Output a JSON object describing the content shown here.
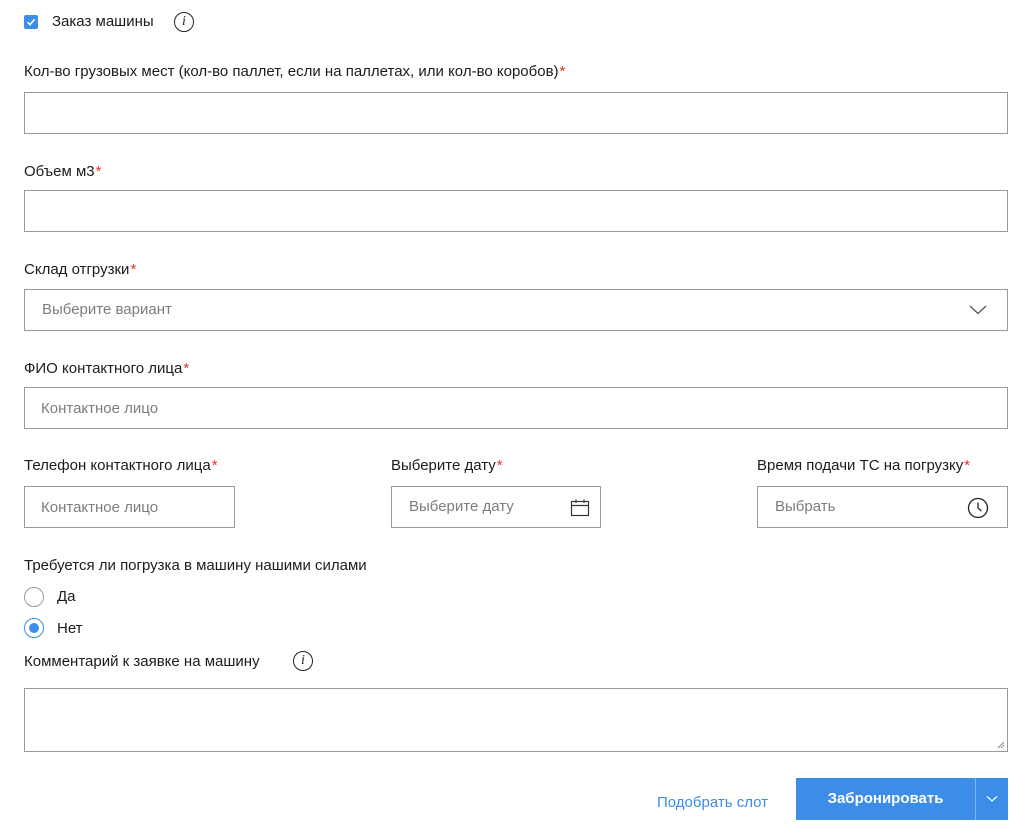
{
  "order_car": {
    "label": "Заказ машины",
    "checked": true
  },
  "cargo_places": {
    "label": "Кол-во грузовых мест (кол-во паллет, если на паллетах, или кол-во коробов)",
    "required_mark": "*",
    "value": ""
  },
  "volume": {
    "label": "Объем м3",
    "required_mark": "*",
    "value": ""
  },
  "warehouse": {
    "label": "Склад отгрузки",
    "required_mark": "*",
    "placeholder": "Выберите вариант"
  },
  "contact_name": {
    "label": "ФИО контактного лица",
    "required_mark": "*",
    "placeholder": "Контактное лицо"
  },
  "contact_phone": {
    "label": "Телефон контактного лица",
    "required_mark": "*",
    "placeholder": "Контактное лицо"
  },
  "date": {
    "label": "Выберите дату",
    "required_mark": "*",
    "placeholder": "Выберите дату"
  },
  "time": {
    "label": "Время подачи ТС на погрузку",
    "required_mark": "*",
    "placeholder": "Выбрать"
  },
  "loading": {
    "question": "Требуется ли погрузка в машину нашими силами",
    "options": [
      {
        "label": "Да",
        "checked": false
      },
      {
        "label": "Нет",
        "checked": true
      }
    ]
  },
  "comment": {
    "label": "Комментарий к заявке на машину",
    "value": ""
  },
  "actions": {
    "pick_slot": "Подобрать слот",
    "book": "Забронировать"
  },
  "colors": {
    "accent": "#3b8de8",
    "required": "#e5352b",
    "border": "#9a9a9a"
  }
}
